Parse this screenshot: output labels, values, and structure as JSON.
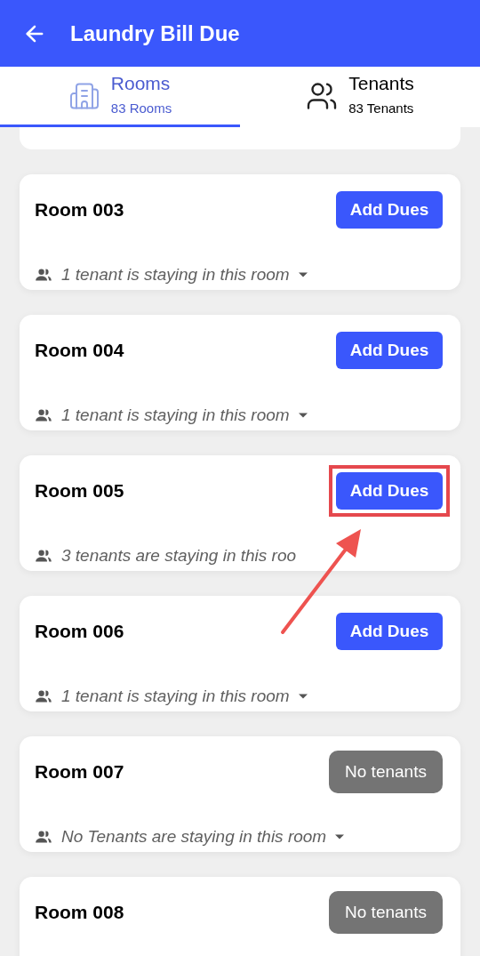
{
  "header": {
    "title": "Laundry Bill Due"
  },
  "tabs": [
    {
      "label": "Rooms",
      "count": "83 Rooms",
      "kind": "rooms",
      "selected": true
    },
    {
      "label": "Tenants",
      "count": "83 Tenants",
      "kind": "tenants",
      "selected": false
    }
  ],
  "rooms": [
    {
      "name": "Room 003",
      "action": "Add Dues",
      "kind": "add",
      "tenants": "1 tenant is staying in this room",
      "highlighted": false
    },
    {
      "name": "Room 004",
      "action": "Add Dues",
      "kind": "add",
      "tenants": "1 tenant is staying in this room",
      "highlighted": false
    },
    {
      "name": "Room 005",
      "action": "Add Dues",
      "kind": "add",
      "tenants": "3 tenants are staying in this roo",
      "highlighted": true
    },
    {
      "name": "Room 006",
      "action": "Add Dues",
      "kind": "add",
      "tenants": "1 tenant is staying in this room",
      "highlighted": false
    },
    {
      "name": "Room 007",
      "action": "No tenants",
      "kind": "empty",
      "tenants": "No Tenants are staying in this room",
      "highlighted": false
    },
    {
      "name": "Room 008",
      "action": "No tenants",
      "kind": "empty",
      "highlighted": false
    }
  ]
}
